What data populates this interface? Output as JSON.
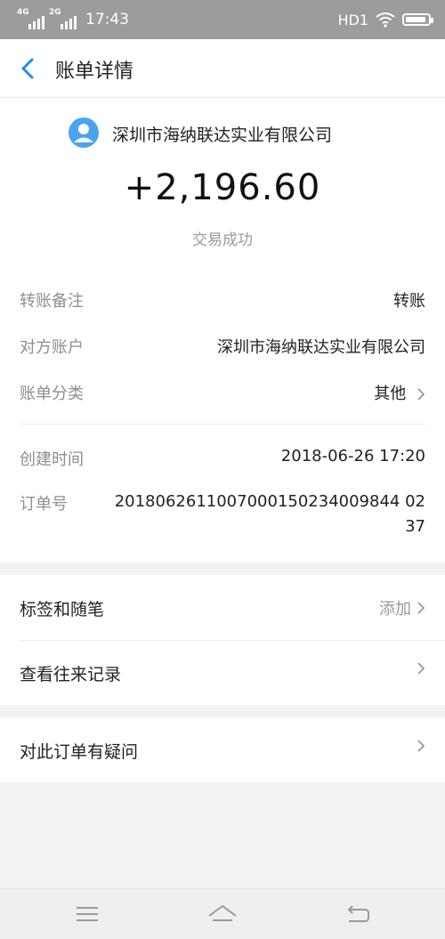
{
  "status_bar": {
    "sim1_tag": "4G",
    "sim2_tag": "2G",
    "time": "17:43",
    "hd_label": "HD1",
    "icons": [
      "signal-icon",
      "wifi-icon",
      "battery-icon"
    ]
  },
  "header": {
    "title": "账单详情",
    "back_icon": "chevron-left-icon"
  },
  "summary": {
    "payee": "深圳市海纳联达实业有限公司",
    "avatar_icon": "user-avatar-icon",
    "amount": "+2,196.60",
    "status": "交易成功"
  },
  "details": {
    "remark_label": "转账备注",
    "remark_value": "转账",
    "counterparty_label": "对方账户",
    "counterparty_value": "深圳市海纳联达实业有限公司",
    "category_label": "账单分类",
    "category_value": "其他",
    "created_label": "创建时间",
    "created_value": "2018-06-26 17:20",
    "order_label": "订单号",
    "order_value": "2018062611007000150234009844 0237"
  },
  "actions": {
    "tags_label": "标签和随笔",
    "tags_action": "添加",
    "history_label": "查看往来记录",
    "question_label": "对此订单有疑问"
  },
  "colors": {
    "accent": "#1d8ff0",
    "status_bar": "#9c9c9c",
    "background": "#f2f2f2"
  },
  "bottom_nav": [
    "menu-icon",
    "home-icon",
    "back-icon"
  ]
}
